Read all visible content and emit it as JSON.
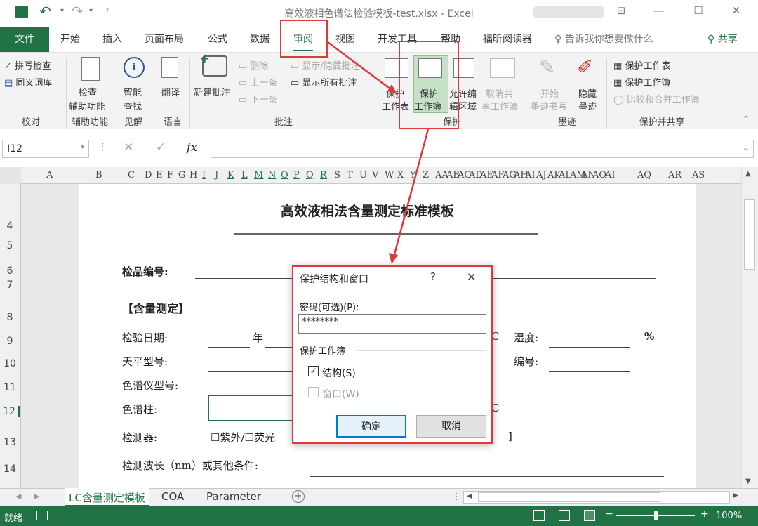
{
  "window": {
    "title": "高效液相色谱法检验模板-test.xlsx - Excel",
    "user": "████████"
  },
  "qat": {
    "save": "save-icon",
    "undo": "undo-icon",
    "redo": "redo-icon",
    "customize": "▾"
  },
  "tabs": [
    "文件",
    "开始",
    "插入",
    "页面布局",
    "公式",
    "数据",
    "审阅",
    "视图",
    "开发工具",
    "帮助",
    "福昕阅读器"
  ],
  "tell_me": "告诉我你想要做什么",
  "share": "共享",
  "ribbon": {
    "proofing": {
      "spell": "拼写检查",
      "thesaurus": "同义词库",
      "label": "校对"
    },
    "accessibility": {
      "check_l1": "检查",
      "check_l2": "辅助功能",
      "label": "辅助功能"
    },
    "insights": {
      "smart_l1": "智能",
      "smart_l2": "查找",
      "label": "见解"
    },
    "language": {
      "translate": "翻译",
      "label": "语言"
    },
    "comments": {
      "new": "新建批注",
      "delete": "删除",
      "prev": "上一条",
      "next": "下一条",
      "show_hide": "显示/隐藏批注",
      "show_all": "显示所有批注",
      "label": "批注"
    },
    "protect": {
      "sheet_l1": "保护",
      "sheet_l2": "工作表",
      "wb_l1": "保护",
      "wb_l2": "工作簿",
      "allow_l1": "允许编",
      "allow_l2": "辑区域",
      "unshare_l1": "取消共",
      "unshare_l2": "享工作簿",
      "label": "保护"
    },
    "ink": {
      "start_l1": "开始",
      "start_l2": "墨迹书写",
      "hide_l1": "隐藏",
      "hide_l2": "墨迹",
      "label": "墨迹"
    },
    "protect_share": {
      "sheet": "保护工作表",
      "workbook": "保护工作簿",
      "compare": "比较和合并工作簿",
      "label": "保护并共享"
    }
  },
  "formula_bar": {
    "name_box": "I12",
    "cancel": "✕",
    "enter": "✓",
    "fx": "fx",
    "value": ""
  },
  "columns": [
    "A",
    "B",
    "C",
    "D",
    "E",
    "F",
    "G",
    "H",
    "I",
    "J",
    "K",
    "L",
    "M",
    "N",
    "O",
    "P",
    "Q",
    "R",
    "S",
    "T",
    "U",
    "V",
    "W",
    "X",
    "Y",
    "Z",
    "AA",
    "AB",
    "AC",
    "AD",
    "AE",
    "AF",
    "AG",
    "AH",
    "AI",
    "AJ",
    "AK",
    "AL",
    "AM",
    "AN",
    "AO",
    "AI",
    "AQ",
    "AR",
    "AS"
  ],
  "rows": [
    "4",
    "5",
    "6",
    "7",
    "8",
    "9",
    "10",
    "11",
    "12",
    "13",
    "14"
  ],
  "sheet": {
    "title": "高效液相法含量测定标准模板",
    "sample_no": "检品编号:",
    "section": "【含量测定】",
    "test_date": "检验日期:",
    "year": "年",
    "c_char": "C",
    "humidity": "湿度:",
    "percent": "%",
    "balance": "天平型号:",
    "number": "编号:",
    "hplc": "色谱仪型号:",
    "column": "色谱柱:",
    "c_char2": "C",
    "detector": "检测器:",
    "detector_opts": "☐紫外/☐荧光",
    "bracket": "]",
    "wavelength": "检测波长（nm）或其他条件:"
  },
  "dialog": {
    "title": "保护结构和窗口",
    "help": "?",
    "close": "✕",
    "password_label": "密码(可选)(P):",
    "password_value": "********",
    "group_label": "保护工作簿",
    "structure": "结构(S)",
    "windows": "窗口(W)",
    "structure_checked": true,
    "windows_checked": false,
    "ok": "确定",
    "cancel": "取消"
  },
  "sheet_tabs": [
    "LC含量测定模板",
    "COA",
    "Parameter"
  ],
  "status": {
    "ready": "就绪",
    "zoom": "100%"
  },
  "colors": {
    "excel_green": "#217346",
    "annotation_red": "#e0393b"
  }
}
